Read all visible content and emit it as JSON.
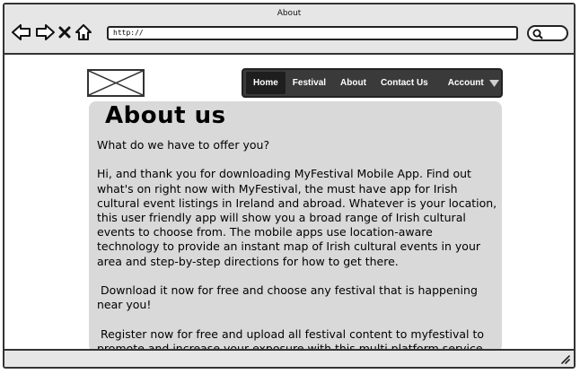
{
  "window": {
    "title": "About"
  },
  "toolbar": {
    "url": "http://",
    "icons": [
      "back-arrow-icon",
      "forward-arrow-icon",
      "close-icon",
      "home-icon",
      "search-icon"
    ]
  },
  "logo": {
    "icon": "image-placeholder-icon"
  },
  "nav": {
    "items": [
      {
        "label": "Home",
        "active": true
      },
      {
        "label": "Festival"
      },
      {
        "label": "About"
      },
      {
        "label": "Contact Us"
      }
    ],
    "account_label": "Account"
  },
  "page": {
    "heading": "About us",
    "paragraphs": [
      "What do we have to offer you?",
      "Hi, and thank you for downloading MyFestival Mobile App. Find out what's on right now with MyFestival, the must have app for Irish cultural event listings in Ireland and abroad. Whatever is your location, this user friendly app will show you a broad range of Irish cultural events to choose from. The mobile apps use location-aware technology to provide an instant map of Irish cultural events in your area and step-by-step directions for how to get there.",
      " Download it now for free and choose any festival that is happening near you!",
      " Register now for free and upload all festival content to myfestival to promote and increase your exposure with this multi platform service."
    ]
  },
  "colors": {
    "navbar": "#3a3a3a",
    "panel": "#d9d9d9",
    "chrome": "#e6e6e6"
  }
}
